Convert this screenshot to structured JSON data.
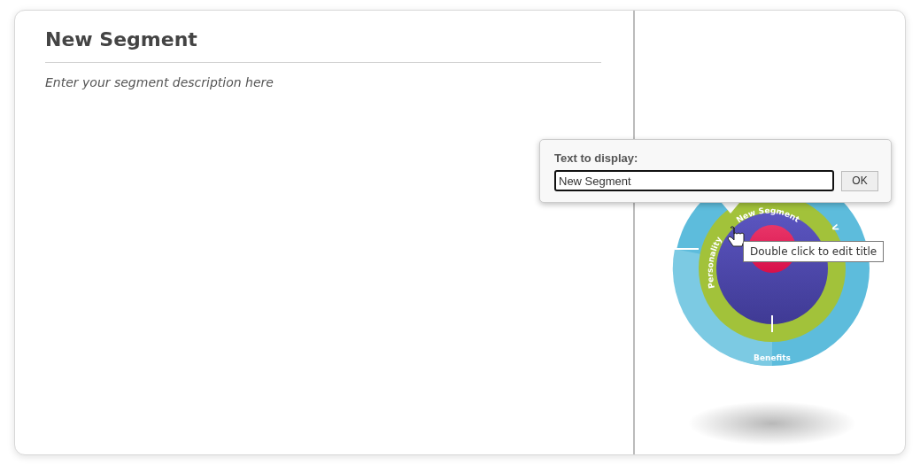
{
  "segment": {
    "title": "New Segment",
    "description": "Enter your segment description here"
  },
  "diagram": {
    "labels": [
      {
        "kind": "inner",
        "text": "New Segment"
      },
      {
        "kind": "left",
        "text": "Personality"
      },
      {
        "kind": "right",
        "text": "V"
      },
      {
        "kind": "outer",
        "text": "Benefits"
      }
    ]
  },
  "popup": {
    "label": "Text to display:",
    "value": "New Segment",
    "button": "OK"
  },
  "tooltip": "Double click to edit title"
}
